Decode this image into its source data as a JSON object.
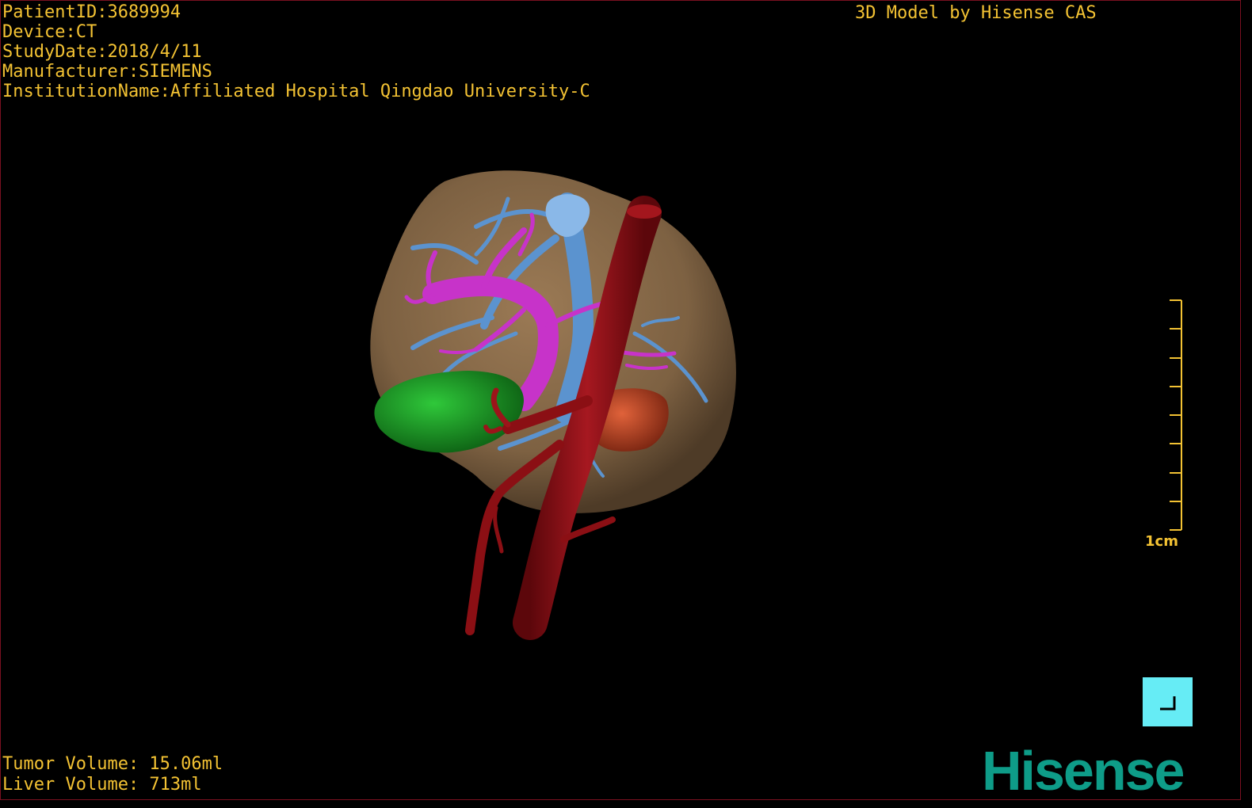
{
  "header": {
    "patient_id": "PatientID:3689994",
    "device": "Device:CT",
    "study_date": "StudyDate:2018/4/11",
    "manufacturer": "Manufacturer:SIEMENS",
    "institution": "InstitutionName:Affiliated Hospital Qingdao University-C"
  },
  "brand_title": "3D Model by Hisense CAS",
  "volumes": {
    "tumor": "Tumor Volume: 15.06ml",
    "liver": "Liver Volume: 713ml"
  },
  "scale_bar": {
    "label": "1cm",
    "tick_count": 9
  },
  "logo_text": "Hisense",
  "colors": {
    "overlay_text": "#f3c233",
    "liver": "#8a6a45",
    "artery": "#8b0f14",
    "portal_vein": "#c733c9",
    "hepatic_vein": "#5b93cf",
    "tumor": "#1b9a22",
    "kidney": "#c24a28",
    "corner_button": "#66ecf5",
    "logo": "#0e9c88",
    "frame_border": "#7a1020"
  },
  "icons": [
    "corner-bracket-icon"
  ]
}
